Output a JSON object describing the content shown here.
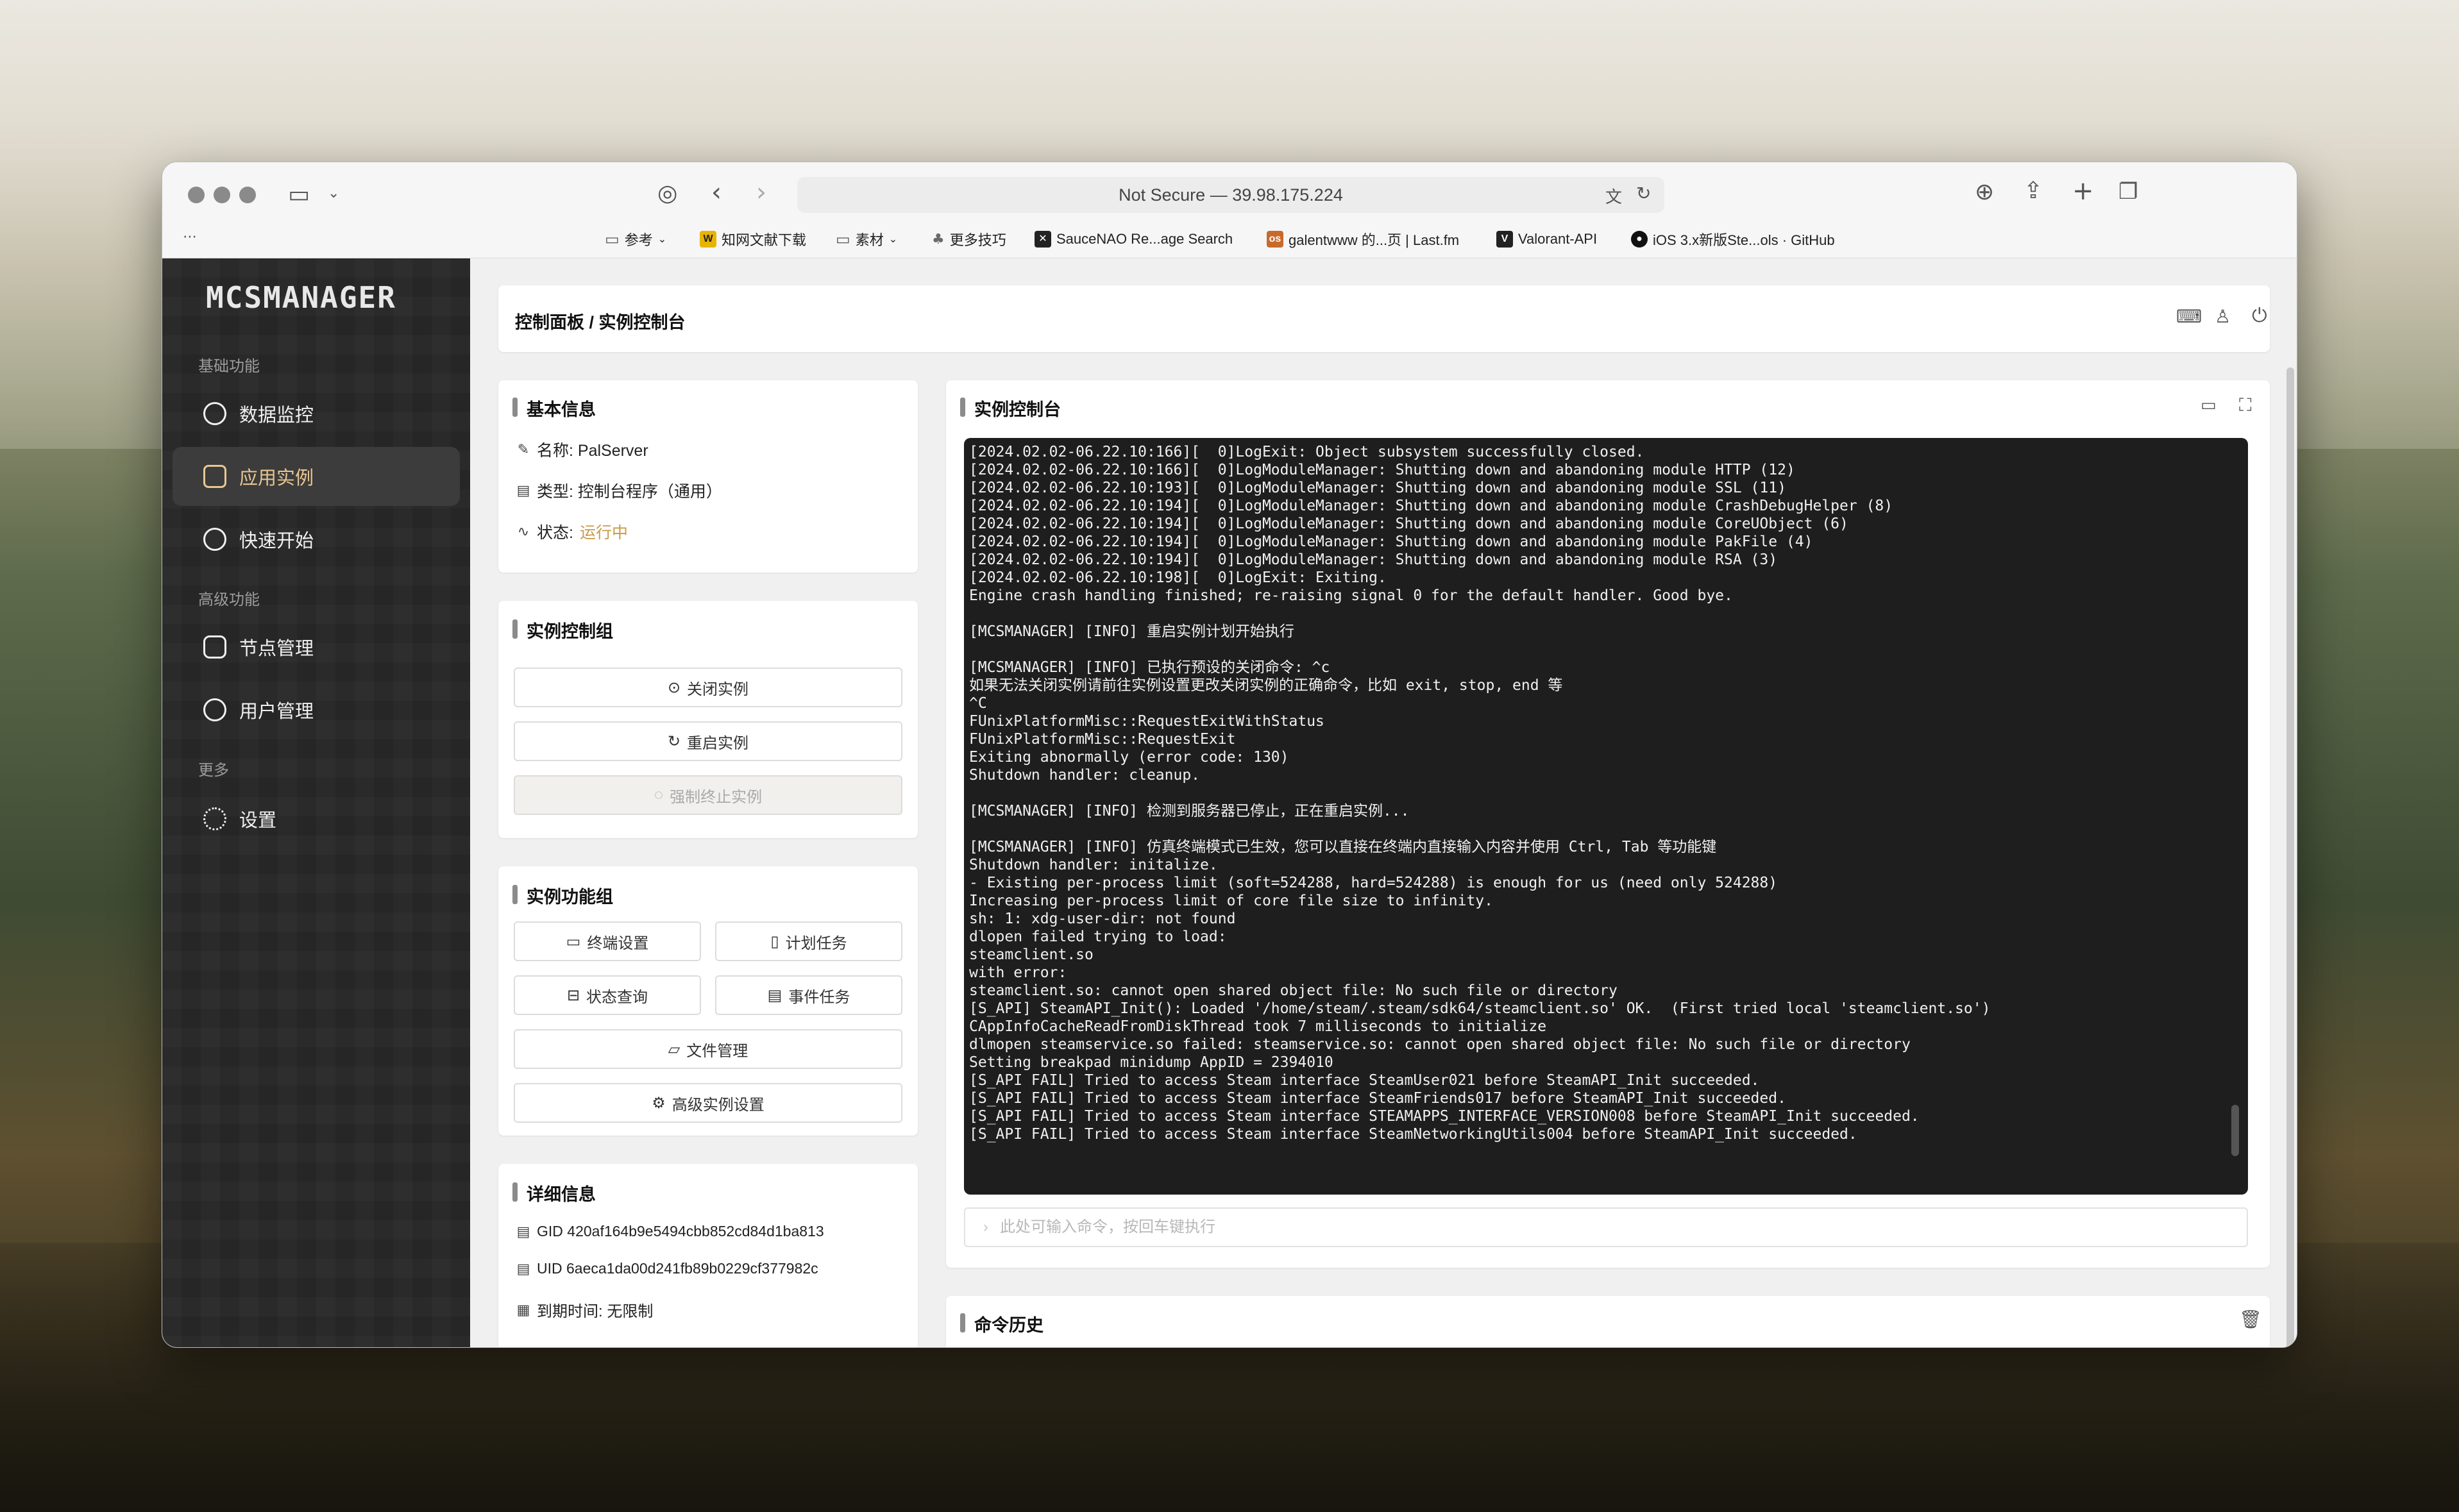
{
  "browser": {
    "url": "Not Secure — 39.98.175.224",
    "bookmarks": [
      {
        "label": "参考",
        "icon": "folder-icon"
      },
      {
        "label": "知网文献下载",
        "icon": "w-icon"
      },
      {
        "label": "素材",
        "icon": "folder-icon"
      },
      {
        "label": "更多技巧",
        "icon": "leaf-icon"
      },
      {
        "label": "SauceNAO Re...age Search",
        "icon": "saucenao-icon"
      },
      {
        "label": "galentwww 的...页 | Last.fm",
        "icon": "lastfm-icon"
      },
      {
        "label": "Valorant-API",
        "icon": "valorant-icon"
      },
      {
        "label": "iOS 3.x新版Ste...ols · GitHub",
        "icon": "github-icon"
      }
    ]
  },
  "sidebar": {
    "logo": "MCSMANAGER",
    "section_basic": "基础功能",
    "section_advanced": "高级功能",
    "section_more": "更多",
    "items": [
      {
        "label": "数据监控",
        "icon": "pie-chart-icon"
      },
      {
        "label": "应用实例",
        "icon": "database-icon"
      },
      {
        "label": "快速开始",
        "icon": "plus-circle-icon"
      },
      {
        "label": "节点管理",
        "icon": "nodes-icon"
      },
      {
        "label": "用户管理",
        "icon": "user-icon"
      },
      {
        "label": "设置",
        "icon": "gear-icon"
      }
    ]
  },
  "header": {
    "breadcrumb": "控制面板 / 实例控制台"
  },
  "basic_info": {
    "title": "基本信息",
    "name": "名称: PalServer",
    "type": "类型: 控制台程序（通用）",
    "status_label": "状态:",
    "status_value": "运行中"
  },
  "control_group": {
    "title": "实例控制组",
    "stop": "关闭实例",
    "restart": "重启实例",
    "kill": "强制终止实例"
  },
  "function_group": {
    "title": "实例功能组",
    "terminal_settings": "终端设置",
    "scheduled_tasks": "计划任务",
    "status_query": "状态查询",
    "event_tasks": "事件任务",
    "file_manager": "文件管理",
    "advanced_settings": "高级实例设置"
  },
  "details": {
    "title": "详细信息",
    "gid": "GID 420af164b9e5494cbb852cd84d1ba813",
    "uid": "UID 6aeca1da00d241fb89b0229cf377982c",
    "expire": "到期时间: 无限制"
  },
  "console": {
    "title": "实例控制台",
    "lines": [
      "[2024.02.02-06.22.10:166][  0]LogExit: Object subsystem successfully closed.",
      "[2024.02.02-06.22.10:166][  0]LogModuleManager: Shutting down and abandoning module HTTP (12)",
      "[2024.02.02-06.22.10:193][  0]LogModuleManager: Shutting down and abandoning module SSL (11)",
      "[2024.02.02-06.22.10:194][  0]LogModuleManager: Shutting down and abandoning module CrashDebugHelper (8)",
      "[2024.02.02-06.22.10:194][  0]LogModuleManager: Shutting down and abandoning module CoreUObject (6)",
      "[2024.02.02-06.22.10:194][  0]LogModuleManager: Shutting down and abandoning module PakFile (4)",
      "[2024.02.02-06.22.10:194][  0]LogModuleManager: Shutting down and abandoning module RSA (3)",
      "[2024.02.02-06.22.10:198][  0]LogExit: Exiting.",
      "Engine crash handling finished; re-raising signal 0 for the default handler. Good bye.",
      "",
      "[MCSMANAGER] [INFO] 重启实例计划开始执行",
      "",
      "[MCSMANAGER] [INFO] 已执行预设的关闭命令: ^c",
      "如果无法关闭实例请前往实例设置更改关闭实例的正确命令，比如 exit, stop, end 等",
      "^C",
      "FUnixPlatformMisc::RequestExitWithStatus",
      "FUnixPlatformMisc::RequestExit",
      "Exiting abnormally (error code: 130)",
      "Shutdown handler: cleanup.",
      "",
      "[MCSMANAGER] [INFO] 检测到服务器已停止，正在重启实例...",
      "",
      "[MCSMANAGER] [INFO] 仿真终端模式已生效，您可以直接在终端内直接输入内容并使用 Ctrl, Tab 等功能键",
      "Shutdown handler: initalize.",
      "- Existing per-process limit (soft=524288, hard=524288) is enough for us (need only 524288)",
      "Increasing per-process limit of core file size to infinity.",
      "sh: 1: xdg-user-dir: not found",
      "dlopen failed trying to load:",
      "steamclient.so",
      "with error:",
      "steamclient.so: cannot open shared object file: No such file or directory",
      "[S_API] SteamAPI_Init(): Loaded '/home/steam/.steam/sdk64/steamclient.so' OK.  (First tried local 'steamclient.so')",
      "CAppInfoCacheReadFromDiskThread took 7 milliseconds to initialize",
      "dlmopen steamservice.so failed: steamservice.so: cannot open shared object file: No such file or directory",
      "Setting breakpad minidump AppID = 2394010",
      "[S_API FAIL] Tried to access Steam interface SteamUser021 before SteamAPI_Init succeeded.",
      "[S_API FAIL] Tried to access Steam interface SteamFriends017 before SteamAPI_Init succeeded.",
      "[S_API FAIL] Tried to access Steam interface STEAMAPPS_INTERFACE_VERSION008 before SteamAPI_Init succeeded.",
      "[S_API FAIL] Tried to access Steam interface SteamNetworkingUtils004 before SteamAPI_Init succeeded."
    ],
    "input_placeholder": "此处可输入命令，按回车键执行"
  },
  "history": {
    "title": "命令历史"
  },
  "colors": {
    "status_running": "#c99a4a",
    "active_nav": "#e8c792"
  }
}
